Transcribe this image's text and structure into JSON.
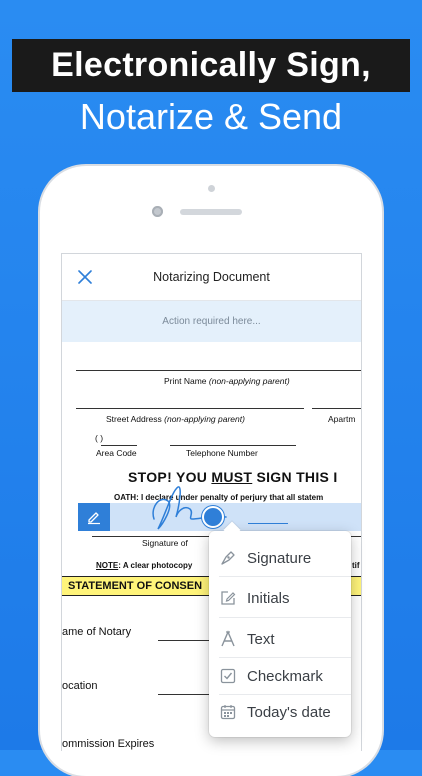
{
  "headline": "Electronically Sign,",
  "subheadline": "Notarize & Send",
  "app": {
    "title": "Notarizing Document",
    "action_banner": "Action required here..."
  },
  "document": {
    "print_name_label": "Print Name",
    "print_name_note": "(non-applying parent)",
    "street_address_label": "Street Address",
    "street_address_note": "(non-applying parent)",
    "apartment_label": "Apartm",
    "area_code_paren": "(         )",
    "area_code_label": "Area Code",
    "telephone_label": "Telephone Number",
    "stop_text_1": "STOP! YOU ",
    "stop_text_must": "MUST",
    "stop_text_2": " SIGN THIS I",
    "oath_text": "OATH:   I declare under penalty of perjury that all statem",
    "signature_of": "Signature of",
    "note_label": "NOTE",
    "note_text": ": A clear photocopy",
    "note_tail": "tif",
    "statement_heading": "STATEMENT OF CONSEN",
    "name_of_notary": "ame of Notary",
    "location": "ocation",
    "commission_expires": "ommission Expires"
  },
  "menu": {
    "items": [
      {
        "label": "Signature",
        "icon": "pen-nib-icon"
      },
      {
        "label": "Initials",
        "icon": "edit-square-icon"
      },
      {
        "label": "Text",
        "icon": "text-a-icon"
      },
      {
        "label": "Checkmark",
        "icon": "checkbox-icon"
      },
      {
        "label": "Today's date",
        "icon": "calendar-icon"
      }
    ]
  },
  "colors": {
    "background": "#2286f0",
    "accent": "#2f7fd8",
    "statement_highlight": "#fff47a",
    "action_banner_bg": "#e4f0fb"
  }
}
